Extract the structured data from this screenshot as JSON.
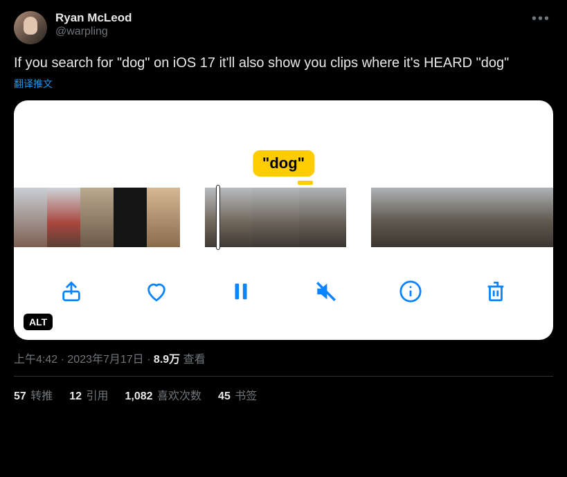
{
  "author": {
    "display_name": "Ryan McLeod",
    "handle": "@warpling"
  },
  "tweet_text": "If you search for \"dog\" on iOS 17 it'll also show you clips where it's HEARD \"dog\"",
  "translate_label": "翻译推文",
  "media": {
    "label": "\"dog\"",
    "alt_badge": "ALT",
    "toolbar": {
      "share": "share",
      "like": "like",
      "pause": "pause",
      "mute": "mute",
      "info": "info",
      "delete": "delete"
    }
  },
  "meta": {
    "time": "上午4:42",
    "date": "2023年7月17日",
    "views_count": "8.9万",
    "views_label": "查看",
    "dot": "·"
  },
  "stats": {
    "retweets": {
      "count": "57",
      "label": "转推"
    },
    "quotes": {
      "count": "12",
      "label": "引用"
    },
    "likes": {
      "count": "1,082",
      "label": "喜欢次数"
    },
    "bookmarks": {
      "count": "45",
      "label": "书签"
    }
  }
}
